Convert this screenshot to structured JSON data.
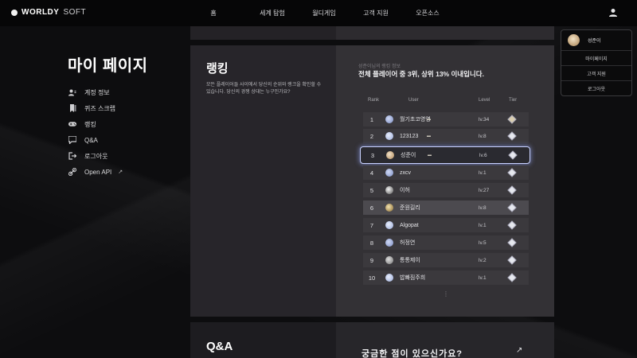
{
  "brand": {
    "name_bold": "WORLDY",
    "name_light": "SOFT"
  },
  "nav": {
    "items": [
      "홈",
      "세계 탐험",
      "월디게임",
      "고객 지원",
      "오픈소스"
    ],
    "user_icon": "user-icon"
  },
  "sidebar": {
    "title": "마이 페이지",
    "items": [
      {
        "label": "계정 정보",
        "icon": "users-icon"
      },
      {
        "label": "퀴즈 스크랩",
        "icon": "bookmark-icon"
      },
      {
        "label": "랭킹",
        "icon": "gamepad-icon"
      },
      {
        "label": "Q&A",
        "icon": "chat-icon"
      },
      {
        "label": "로그아웃",
        "icon": "logout-icon"
      },
      {
        "label": "Open API",
        "icon": "link-icon",
        "extra": "↗"
      }
    ]
  },
  "ranking": {
    "title": "랭킹",
    "description": "모든 플레이어들 사이에서 당신의 순위와 랭크을 확인할 수 있습니다. 당신의 경쟁 상대는 누구인가요?",
    "caption": "성준이님의 랭킹 정보",
    "summary": "전체 플레이어 중 3위, 상위 13% 이내입니다.",
    "columns": {
      "rank": "Rank",
      "user": "User",
      "level": "Level",
      "tier": "Tier"
    },
    "rows": [
      {
        "rank": "1",
        "name": "월기초코영영",
        "badge": "▬",
        "level": "lv.34"
      },
      {
        "rank": "2",
        "name": "123123",
        "badge": "▬",
        "level": "lv.8"
      },
      {
        "rank": "3",
        "name": "성준이",
        "badge": "▬",
        "level": "lv.6"
      },
      {
        "rank": "4",
        "name": "zxcv",
        "badge": "",
        "level": "lv.1"
      },
      {
        "rank": "5",
        "name": "이허",
        "badge": "",
        "level": "lv.27"
      },
      {
        "rank": "6",
        "name": "준원길리",
        "badge": "",
        "level": "lv.8"
      },
      {
        "rank": "7",
        "name": "Algopat",
        "badge": "",
        "level": "lv.1"
      },
      {
        "rank": "8",
        "name": "허정연",
        "badge": "",
        "level": "lv.5"
      },
      {
        "rank": "9",
        "name": "통통제이",
        "badge": "",
        "level": "lv.2"
      },
      {
        "rank": "10",
        "name": "밥빠짐주희",
        "badge": "",
        "level": "lv.1"
      }
    ],
    "more": "⋮"
  },
  "account": {
    "name": "성준이",
    "items": [
      "마이페이지",
      "고객 지원",
      "로그아웃"
    ]
  },
  "qa": {
    "title": "Q&A",
    "question": "궁금한 점이 있으신가요?",
    "arrow": "↗"
  }
}
